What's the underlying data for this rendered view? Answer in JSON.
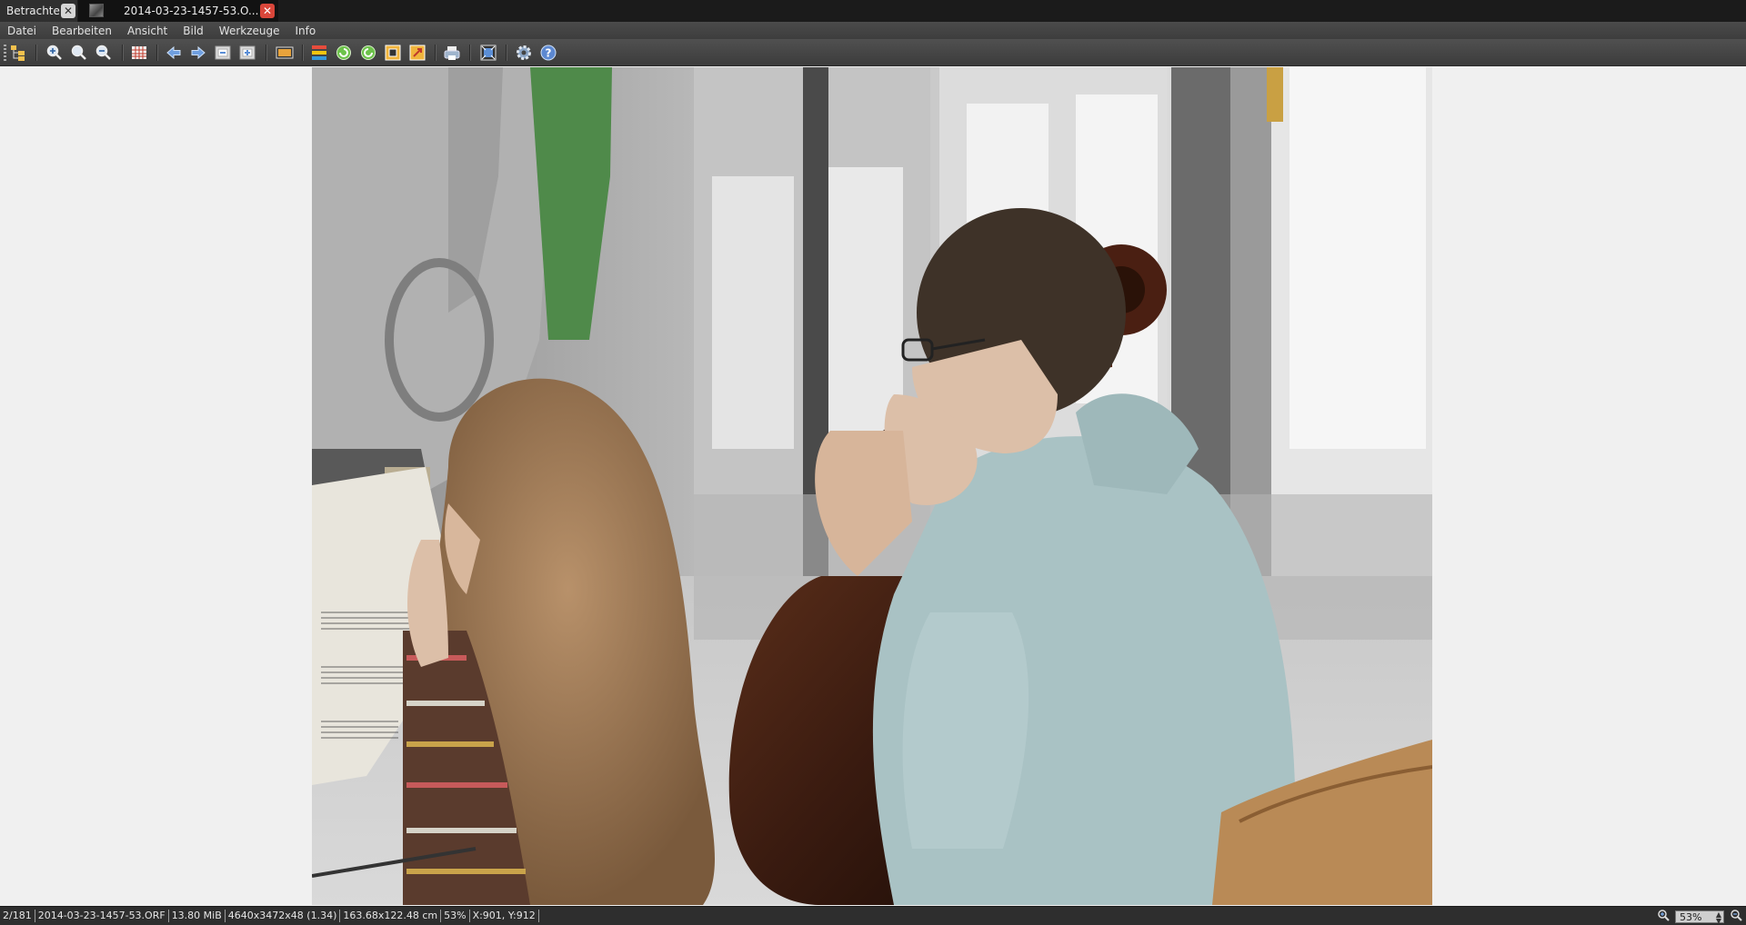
{
  "tabs": [
    {
      "label": "Betrachter",
      "close": "✕"
    },
    {
      "label": "2014-03-23-1457-53.O...",
      "close": "✕"
    }
  ],
  "menu": [
    "Datei",
    "Bearbeiten",
    "Ansicht",
    "Bild",
    "Werkzeuge",
    "Info"
  ],
  "toolbar_icons": [
    "folder-tree-icon",
    "zoom-in-icon",
    "zoom-fit-icon",
    "zoom-out-icon",
    "thumbnail-grid-icon",
    "previous-icon",
    "next-icon",
    "first-image-icon",
    "last-image-icon",
    "slideshow-icon",
    "adjust-colors-icon",
    "rotate-left-icon",
    "rotate-right-icon",
    "crop-icon",
    "resize-icon",
    "print-icon",
    "fullscreen-icon",
    "settings-icon",
    "help-icon"
  ],
  "image": {
    "alt_icon": "photo-icon"
  },
  "status": {
    "index": "2/181",
    "filename": "2014-03-23-1457-53.ORF",
    "filesize": "13.80 MiB",
    "dimensions": "4640x3472x48 (1.34)",
    "print_size": "163.68x122.48 cm",
    "zoom_percent": "53%",
    "cursor": "X:901, Y:912",
    "zoom_box": "53%"
  },
  "colors": {
    "tabbar": "#1b1b1b",
    "toolbar": "#474747",
    "viewer_bg": "#f0f0f0",
    "close_red": "#d9463a"
  }
}
